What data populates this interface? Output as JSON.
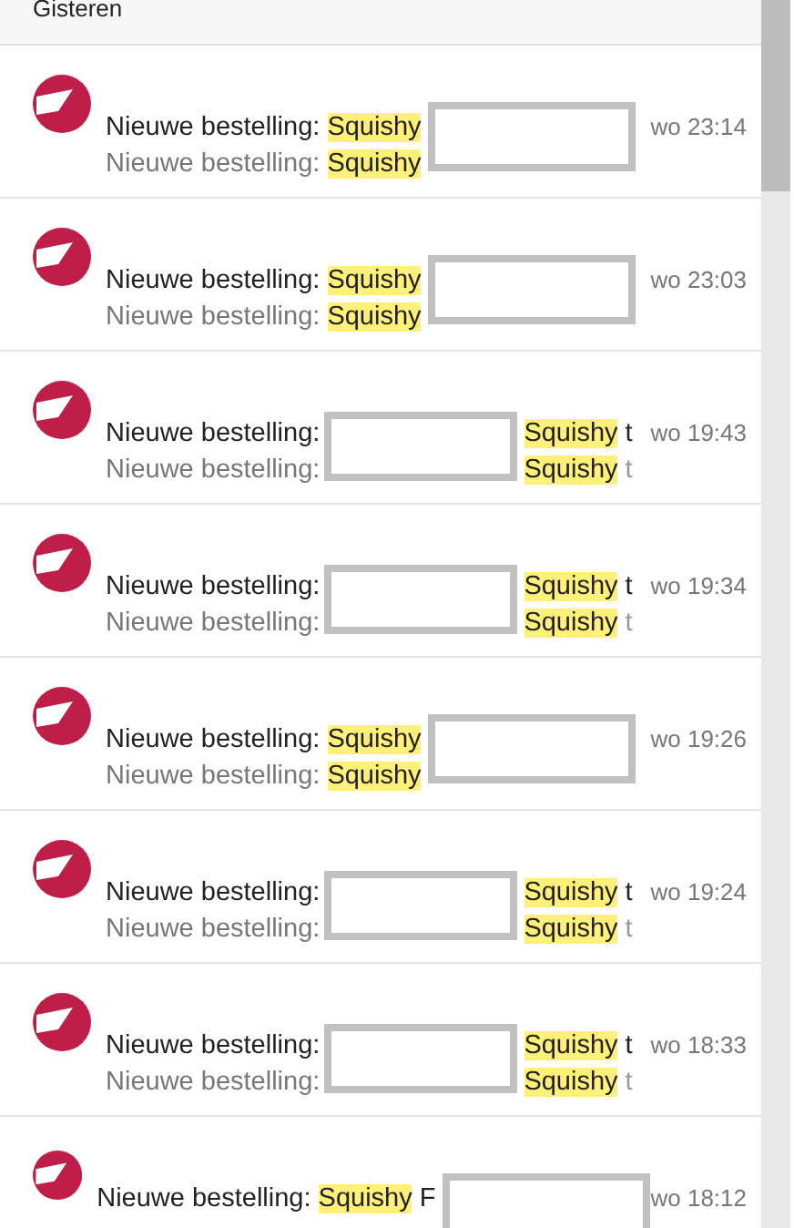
{
  "header": {
    "label": "Gisteren"
  },
  "messages": [
    {
      "kind": "highlight_first",
      "subject_prefix": "Nieuwe bestelling:",
      "subject_highlight": "Squishy",
      "preview_prefix": "Nieuwe bestelling:",
      "preview_highlight": "Squishy",
      "time": "wo 23:14"
    },
    {
      "kind": "highlight_first",
      "subject_prefix": "Nieuwe bestelling:",
      "subject_highlight": "Squishy",
      "preview_prefix": "Nieuwe bestelling:",
      "preview_highlight": "Squishy",
      "time": "wo 23:03"
    },
    {
      "kind": "redaction_first",
      "subject_prefix": "Nieuwe bestelling:",
      "subject_highlight": "Squishy",
      "subject_trailing": "t",
      "preview_prefix": "Nieuwe bestelling:",
      "preview_highlight": "Squishy",
      "preview_trailing": "t",
      "time": "wo 19:43"
    },
    {
      "kind": "redaction_first",
      "subject_prefix": "Nieuwe bestelling:",
      "subject_highlight": "Squishy",
      "subject_trailing": "t",
      "preview_prefix": "Nieuwe bestelling:",
      "preview_highlight": "Squishy",
      "preview_trailing": "t",
      "time": "wo 19:34"
    },
    {
      "kind": "highlight_first",
      "subject_prefix": "Nieuwe bestelling:",
      "subject_highlight": "Squishy",
      "preview_prefix": "Nieuwe bestelling:",
      "preview_highlight": "Squishy",
      "time": "wo 19:26"
    },
    {
      "kind": "redaction_first",
      "subject_prefix": "Nieuwe bestelling:",
      "subject_highlight": "Squishy",
      "subject_trailing": "t",
      "preview_prefix": "Nieuwe bestelling:",
      "preview_highlight": "Squishy",
      "preview_trailing": "t",
      "time": "wo 19:24"
    },
    {
      "kind": "redaction_first",
      "subject_prefix": "Nieuwe bestelling:",
      "subject_highlight": "Squishy",
      "subject_trailing": "t",
      "preview_prefix": "Nieuwe bestelling:",
      "preview_highlight": "Squishy",
      "preview_trailing": "t",
      "time": "wo 18:33"
    },
    {
      "kind": "highlight_first",
      "subject_prefix": "Nieuwe bestelling:",
      "subject_highlight": "Squishy",
      "subject_trailing": "F",
      "time": "wo 18:12"
    }
  ]
}
